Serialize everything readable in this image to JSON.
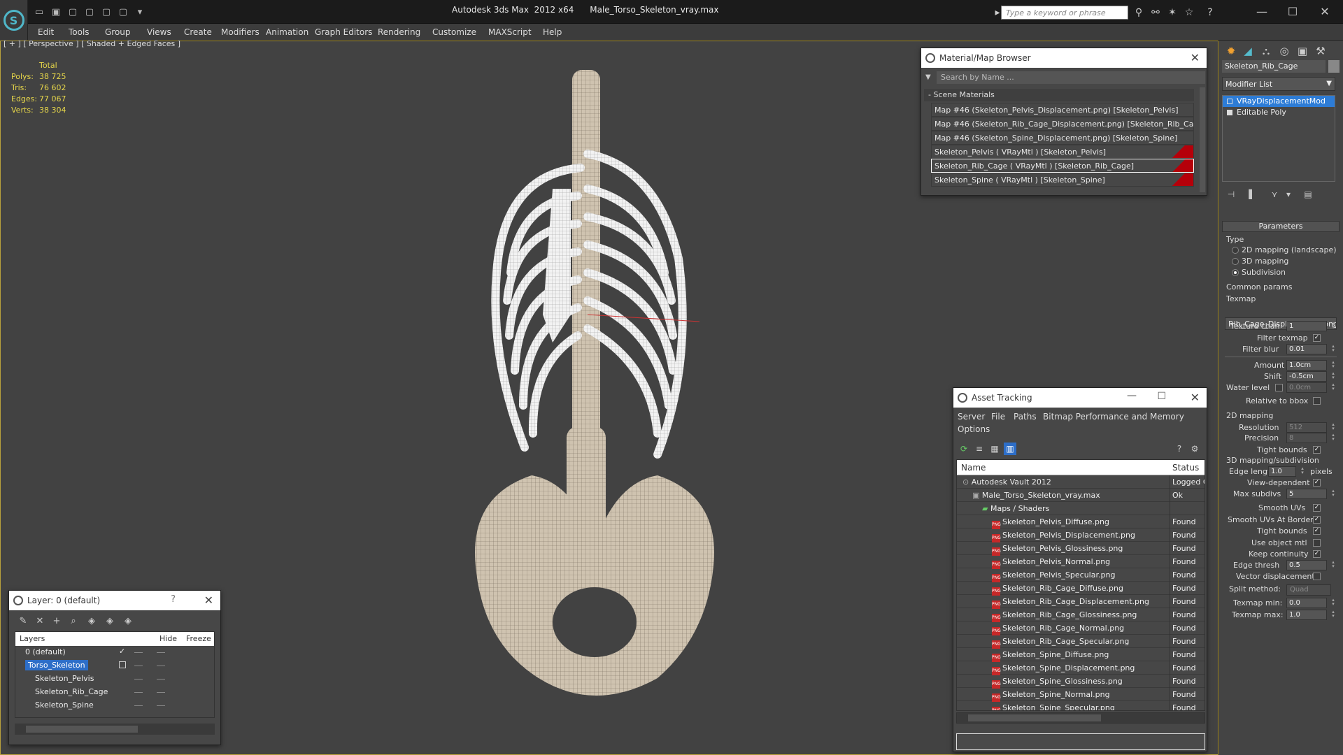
{
  "window": {
    "title": "Autodesk 3ds Max  2012 x64      Male_Torso_Skeleton_vray.max",
    "search_placeholder": "Type a keyword or phrase"
  },
  "menu": [
    "Edit",
    "Tools",
    "Group",
    "Views",
    "Create",
    "Modifiers",
    "Animation",
    "Graph Editors",
    "Rendering",
    "Customize",
    "MAXScript",
    "Help"
  ],
  "viewport": {
    "label": "[ + ] [ Perspective ] [ Shaded + Edged Faces ]",
    "stats_header": "Total",
    "stats": [
      {
        "label": "Polys:",
        "value": "38 725"
      },
      {
        "label": "Tris:",
        "value": "76 602"
      },
      {
        "label": "Edges:",
        "value": "77 067"
      },
      {
        "label": "Verts:",
        "value": "38 304"
      }
    ]
  },
  "material_browser": {
    "title": "Material/Map Browser",
    "search_placeholder": "Search by Name ...",
    "section": "- Scene Materials",
    "items": [
      {
        "label": "Map #46 (Skeleton_Pelvis_Displacement.png) [Skeleton_Pelvis]",
        "swatch": false,
        "selected": false
      },
      {
        "label": "Map #46 (Skeleton_Rib_Cage_Displacement.png) [Skeleton_Rib_Cage]",
        "swatch": false,
        "selected": false
      },
      {
        "label": "Map #46 (Skeleton_Spine_Displacement.png) [Skeleton_Spine]",
        "swatch": false,
        "selected": false
      },
      {
        "label": "Skeleton_Pelvis  ( VRayMtl ) [Skeleton_Pelvis]",
        "swatch": true,
        "selected": false
      },
      {
        "label": "Skeleton_Rib_Cage  ( VRayMtl ) [Skeleton_Rib_Cage]",
        "swatch": true,
        "selected": true
      },
      {
        "label": "Skeleton_Spine  ( VRayMtl ) [Skeleton_Spine]",
        "swatch": true,
        "selected": false
      }
    ]
  },
  "asset_tracking": {
    "title": "Asset Tracking",
    "menu": [
      "Server",
      "File",
      "Paths",
      "Bitmap Performance and Memory",
      "Options"
    ],
    "columns": [
      "Name",
      "Status"
    ],
    "rows": [
      {
        "name": "Autodesk Vault 2012",
        "status": "Logged C",
        "indent": 1,
        "icon": "vault"
      },
      {
        "name": "Male_Torso_Skeleton_vray.max",
        "status": "Ok",
        "indent": 2,
        "icon": "max"
      },
      {
        "name": "Maps / Shaders",
        "status": "",
        "indent": 3,
        "icon": "maps"
      },
      {
        "name": "Skeleton_Pelvis_Diffuse.png",
        "status": "Found",
        "indent": 4,
        "icon": "png"
      },
      {
        "name": "Skeleton_Pelvis_Displacement.png",
        "status": "Found",
        "indent": 4,
        "icon": "png"
      },
      {
        "name": "Skeleton_Pelvis_Glossiness.png",
        "status": "Found",
        "indent": 4,
        "icon": "png"
      },
      {
        "name": "Skeleton_Pelvis_Normal.png",
        "status": "Found",
        "indent": 4,
        "icon": "png"
      },
      {
        "name": "Skeleton_Pelvis_Specular.png",
        "status": "Found",
        "indent": 4,
        "icon": "png"
      },
      {
        "name": "Skeleton_Rib_Cage_Diffuse.png",
        "status": "Found",
        "indent": 4,
        "icon": "png"
      },
      {
        "name": "Skeleton_Rib_Cage_Displacement.png",
        "status": "Found",
        "indent": 4,
        "icon": "png"
      },
      {
        "name": "Skeleton_Rib_Cage_Glossiness.png",
        "status": "Found",
        "indent": 4,
        "icon": "png"
      },
      {
        "name": "Skeleton_Rib_Cage_Normal.png",
        "status": "Found",
        "indent": 4,
        "icon": "png"
      },
      {
        "name": "Skeleton_Rib_Cage_Specular.png",
        "status": "Found",
        "indent": 4,
        "icon": "png"
      },
      {
        "name": "Skeleton_Spine_Diffuse.png",
        "status": "Found",
        "indent": 4,
        "icon": "png"
      },
      {
        "name": "Skeleton_Spine_Displacement.png",
        "status": "Found",
        "indent": 4,
        "icon": "png"
      },
      {
        "name": "Skeleton_Spine_Glossiness.png",
        "status": "Found",
        "indent": 4,
        "icon": "png"
      },
      {
        "name": "Skeleton_Spine_Normal.png",
        "status": "Found",
        "indent": 4,
        "icon": "png"
      },
      {
        "name": "Skeleton_Spine_Specular.png",
        "status": "Found",
        "indent": 4,
        "icon": "png"
      }
    ]
  },
  "layer_panel": {
    "title": "Layer: 0 (default)",
    "help": "?",
    "columns": [
      "Layers",
      "Hide",
      "Freeze"
    ],
    "rows": [
      {
        "name": "0 (default)",
        "indent": 1,
        "selected": false,
        "current": true
      },
      {
        "name": "Torso_Skeleton",
        "indent": 1,
        "selected": true,
        "current": false
      },
      {
        "name": "Skeleton_Pelvis",
        "indent": 2,
        "selected": false,
        "current": false
      },
      {
        "name": "Skeleton_Rib_Cage",
        "indent": 2,
        "selected": false,
        "current": false
      },
      {
        "name": "Skeleton_Spine",
        "indent": 2,
        "selected": false,
        "current": false
      }
    ]
  },
  "command_panel": {
    "object_name": "Skeleton_Rib_Cage",
    "modifier_list": "Modifier List",
    "stack": [
      {
        "label": "VRayDisplacementMod",
        "selected": true
      },
      {
        "label": "Editable Poly",
        "selected": false
      }
    ],
    "rollout": "Parameters",
    "type_label": "Type",
    "type_options": [
      {
        "label": "2D mapping (landscape)",
        "checked": false
      },
      {
        "label": "3D mapping",
        "checked": false
      },
      {
        "label": "Subdivision",
        "checked": true
      }
    ],
    "common_params": "Common params",
    "texmap_label": "Texmap",
    "texmap_value": "Rib_Cage_Displacement.png)",
    "texture_chan": {
      "label": "Texture chan",
      "value": "1"
    },
    "filter_texmap": {
      "label": "Filter texmap",
      "checked": true
    },
    "filter_blur": {
      "label": "Filter blur",
      "value": "0.01"
    },
    "amount": {
      "label": "Amount",
      "value": "1.0cm"
    },
    "shift": {
      "label": "Shift",
      "value": "-0.5cm"
    },
    "water_level": {
      "label": "Water level",
      "value": "0.0cm",
      "checked": false
    },
    "relative_to_bbox": {
      "label": "Relative to bbox",
      "checked": false
    },
    "mapping_2d": "2D mapping",
    "resolution": {
      "label": "Resolution",
      "value": "512"
    },
    "precision": {
      "label": "Precision",
      "value": "8"
    },
    "tight_bounds_2d": {
      "label": "Tight bounds",
      "checked": true
    },
    "mapping_3d": "3D mapping/subdivision",
    "edge_length": {
      "label": "Edge length",
      "value": "1.0",
      "unit": "pixels"
    },
    "view_dependent": {
      "label": "View-dependent",
      "checked": true
    },
    "max_subdivs": {
      "label": "Max subdivs",
      "value": "5"
    },
    "smooth_uvs": {
      "label": "Smooth UVs",
      "checked": true
    },
    "smooth_uvs_borders": {
      "label": "Smooth UVs At Borders",
      "checked": true
    },
    "tight_bounds_3d": {
      "label": "Tight bounds",
      "checked": true
    },
    "use_object_mtl": {
      "label": "Use object mtl",
      "checked": false
    },
    "keep_continuity": {
      "label": "Keep continuity",
      "checked": true
    },
    "edge_thresh": {
      "label": "Edge thresh",
      "value": "0.5"
    },
    "vector_displacement": {
      "label": "Vector displacement",
      "checked": false
    },
    "split_method": {
      "label": "Split method:",
      "value": "Quad"
    },
    "texmap_min": {
      "label": "Texmap min:",
      "value": "0.0"
    },
    "texmap_max": {
      "label": "Texmap max:",
      "value": "1.0"
    }
  },
  "colors": {
    "selection": "#2d6ec8",
    "viewport_border": "#b8a13c",
    "stats": "#e6d64a",
    "material_swatch": "#b5000a"
  }
}
